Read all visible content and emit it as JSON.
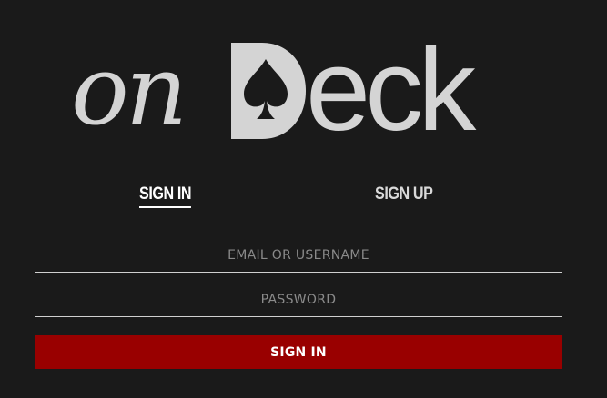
{
  "logo": {
    "script_part": "on",
    "letter_d": "D",
    "rest_part": "eck",
    "color": "#d4d4d4",
    "icon": "spade-icon"
  },
  "tabs": [
    {
      "label": "SIGN IN",
      "active": true
    },
    {
      "label": "SIGN UP",
      "active": false
    }
  ],
  "form": {
    "email_placeholder": "EMAIL OR USERNAME",
    "email_value": "",
    "password_placeholder": "PASSWORD",
    "password_value": "",
    "submit_label": "SIGN IN"
  },
  "colors": {
    "background": "#1a1a1a",
    "accent": "#990000",
    "text": "#ffffff",
    "logo": "#d4d4d4"
  }
}
